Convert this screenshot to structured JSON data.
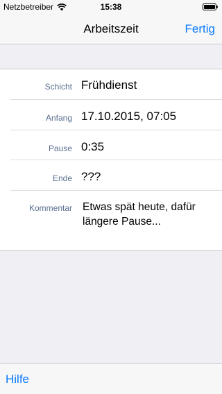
{
  "status_bar": {
    "carrier": "Netzbetreiber",
    "time": "15:38",
    "icons": [
      "wifi-icon",
      "battery-icon"
    ]
  },
  "nav": {
    "title": "Arbeitszeit",
    "done_label": "Fertig"
  },
  "form": {
    "rows": [
      {
        "label": "Schicht",
        "value": "Frühdienst"
      },
      {
        "label": "Anfang",
        "value": "17.10.2015, 07:05"
      },
      {
        "label": "Pause",
        "value": "0:35"
      },
      {
        "label": "Ende",
        "value": "???"
      },
      {
        "label": "Kommentar",
        "value": "Etwas spät heute, dafür längere Pause..."
      }
    ]
  },
  "toolbar": {
    "help_label": "Hilfe"
  },
  "colors": {
    "accent": "#0a7aff",
    "label": "#5a6f8f",
    "background": "#efeff4"
  }
}
